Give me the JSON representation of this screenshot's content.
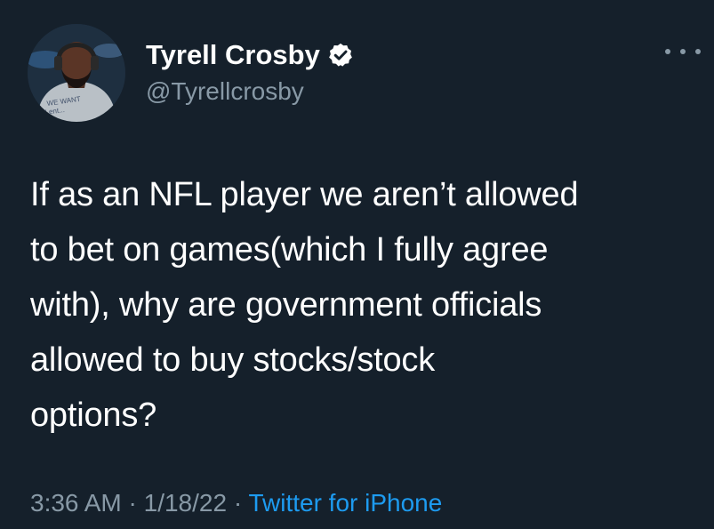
{
  "author": {
    "display_name": "Tyrell Crosby",
    "handle": "@Tyrellcrosby",
    "avatar_icon": "profile-photo-headphones",
    "verified_icon": "verified-badge-icon",
    "shirt_text": "WE WANT\nLent..."
  },
  "tweet": {
    "text": "If as an NFL player we aren’t allowed\nto bet on games(which I fully agree\nwith), why are government officials\nallowed to buy stocks/stock\noptions?",
    "time": "3:36 AM",
    "date": "1/18/22",
    "separator": "·",
    "source": "Twitter for iPhone"
  },
  "menu": {
    "more_icon": "more-options-icon"
  },
  "colors": {
    "background": "#15202b",
    "primary_text": "#ffffff",
    "secondary_text": "#8899a6",
    "link": "#1d9bf0"
  }
}
